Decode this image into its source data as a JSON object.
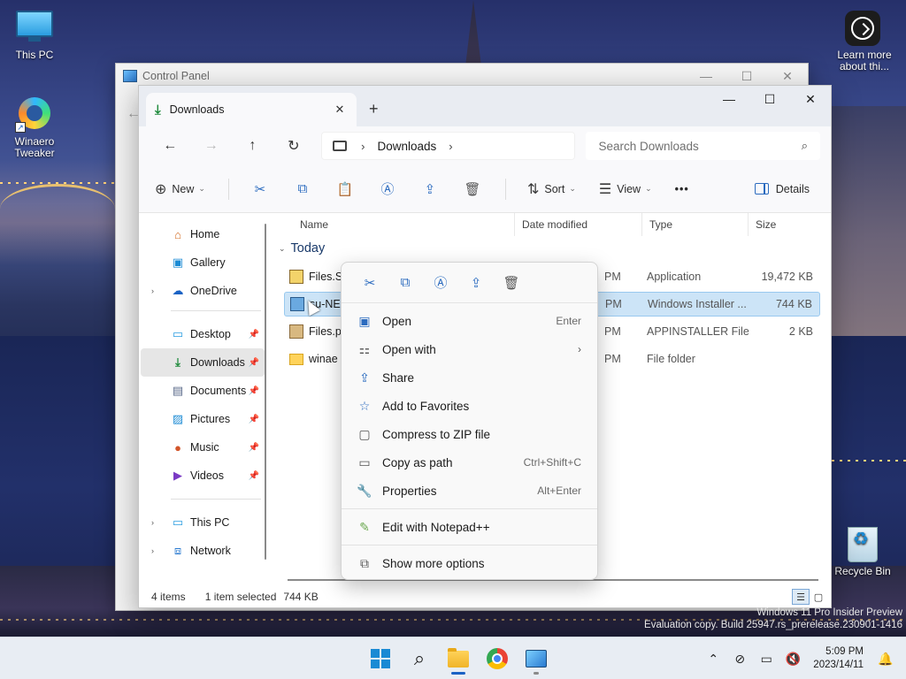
{
  "desktop": {
    "icons": [
      {
        "label": "This PC"
      },
      {
        "label": "Winaero Tweaker"
      },
      {
        "label": "Learn more about thi..."
      },
      {
        "label": "Recycle Bin"
      }
    ],
    "watermark": {
      "line1": "Windows 11 Pro Insider Preview",
      "line2": "Evaluation copy. Build 25947.rs_prerelease.230901-1416"
    }
  },
  "control_panel": {
    "title": "Control Panel"
  },
  "explorer": {
    "tab": {
      "label": "Downloads",
      "close": "✕",
      "new_tab": "+"
    },
    "window_controls": {
      "minimize": "—",
      "maximize": "☐",
      "close": "✕"
    },
    "address": {
      "crumbs": [
        "Downloads"
      ]
    },
    "search": {
      "placeholder": "Search Downloads"
    },
    "toolbar": {
      "new_label": "New",
      "sort_label": "Sort",
      "view_label": "View",
      "more_label": "•••",
      "details_label": "Details"
    },
    "nav": {
      "items": [
        {
          "label": "Home",
          "icon": "home-icon"
        },
        {
          "label": "Gallery",
          "icon": "gallery-icon"
        },
        {
          "label": "OneDrive",
          "icon": "onedrive-icon"
        },
        {
          "label": "Desktop",
          "icon": "desktop-icon"
        },
        {
          "label": "Downloads",
          "icon": "downloads-icon"
        },
        {
          "label": "Documents",
          "icon": "documents-icon"
        },
        {
          "label": "Pictures",
          "icon": "pictures-icon"
        },
        {
          "label": "Music",
          "icon": "music-icon"
        },
        {
          "label": "Videos",
          "icon": "videos-icon"
        },
        {
          "label": "This PC",
          "icon": "this-pc-icon"
        },
        {
          "label": "Network",
          "icon": "network-icon"
        }
      ]
    },
    "columns": {
      "name": "Name",
      "date": "Date modified",
      "type": "Type",
      "size": "Size"
    },
    "group": "Today",
    "files": [
      {
        "name": "Files.S",
        "date": "PM",
        "type": "Application",
        "size": "19,472 KB"
      },
      {
        "name": "su-NE",
        "date": "PM",
        "type": "Windows Installer ...",
        "size": "744 KB"
      },
      {
        "name": "Files.p",
        "date": "PM",
        "type": "APPINSTALLER File",
        "size": "2 KB"
      },
      {
        "name": "winae",
        "date": "PM",
        "type": "File folder",
        "size": ""
      }
    ],
    "status": {
      "count": "4 items",
      "selection": "1 item selected",
      "sel_size": "744 KB"
    }
  },
  "context_menu": {
    "items": [
      {
        "label": "Open",
        "shortcut": "Enter"
      },
      {
        "label": "Open with",
        "shortcut": "›"
      },
      {
        "label": "Share",
        "shortcut": ""
      },
      {
        "label": "Add to Favorites",
        "shortcut": ""
      },
      {
        "label": "Compress to ZIP file",
        "shortcut": ""
      },
      {
        "label": "Copy as path",
        "shortcut": "Ctrl+Shift+C"
      },
      {
        "label": "Properties",
        "shortcut": "Alt+Enter"
      },
      {
        "label": "Edit with Notepad++",
        "shortcut": ""
      },
      {
        "label": "Show more options",
        "shortcut": ""
      }
    ]
  },
  "taskbar": {
    "clock_time": "5:09 PM",
    "clock_date": "2023/14/11"
  },
  "colors": {
    "accent": "#1a62c4",
    "selection": "#cce4f7"
  }
}
